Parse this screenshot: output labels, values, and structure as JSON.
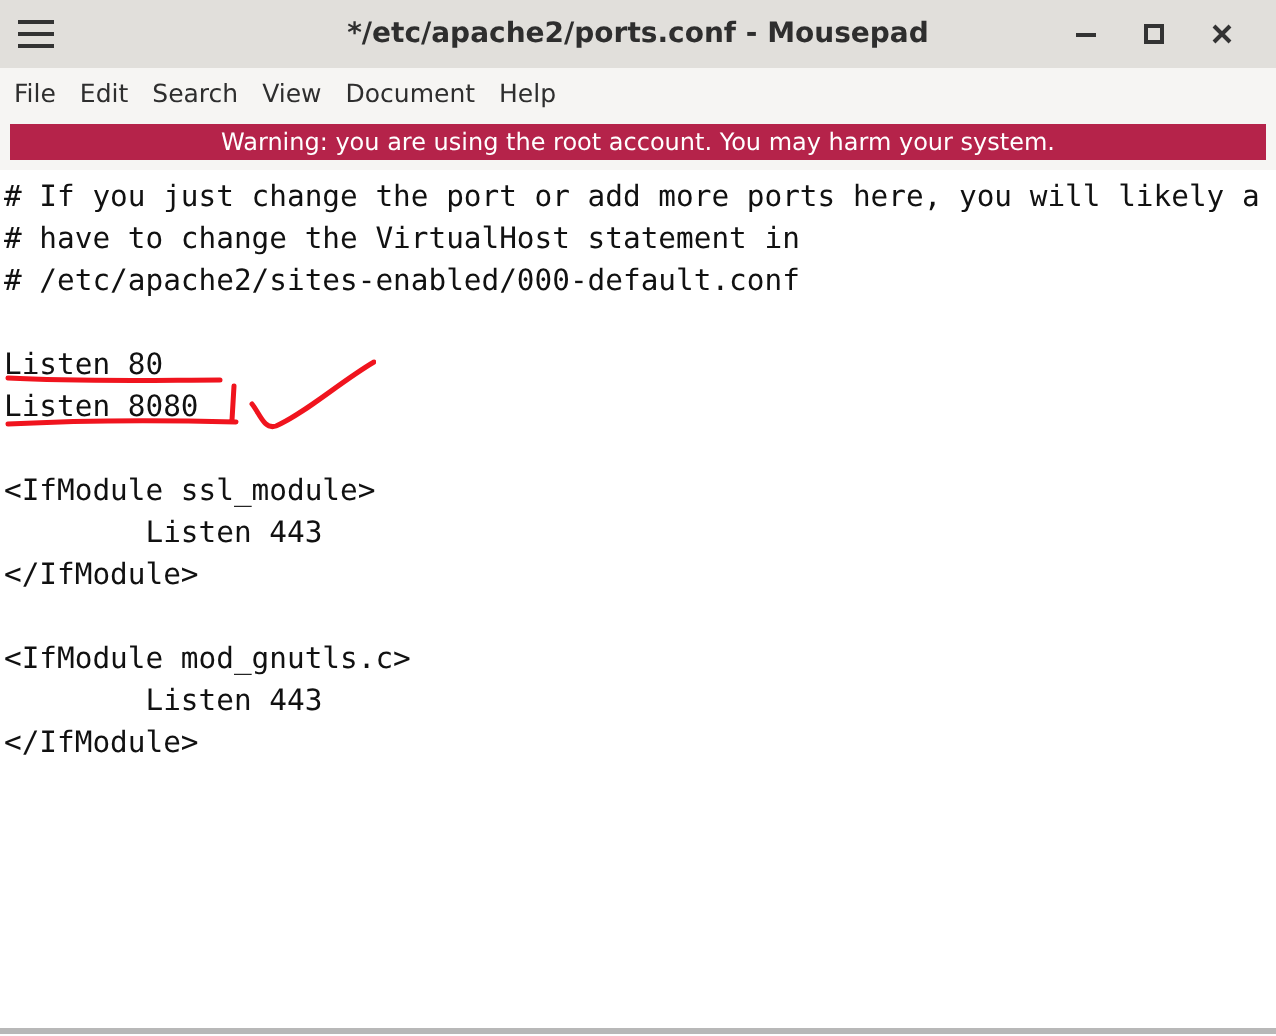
{
  "window": {
    "title": "*/etc/apache2/ports.conf - Mousepad"
  },
  "menu": [
    "File",
    "Edit",
    "Search",
    "View",
    "Document",
    "Help"
  ],
  "warning": "Warning: you are using the root account. You may harm your system.",
  "lines": [
    {
      "kind": "code",
      "text": "# If you just change the port or add more ports here, you will likely a"
    },
    {
      "kind": "code",
      "text": "# have to change the VirtualHost statement in"
    },
    {
      "kind": "code",
      "text": "# /etc/apache2/sites-enabled/000-default.conf"
    },
    {
      "kind": "blank"
    },
    {
      "kind": "code",
      "text": "Listen 80"
    },
    {
      "kind": "code",
      "text": "Listen 8080"
    },
    {
      "kind": "blank"
    },
    {
      "kind": "code",
      "text": "<IfModule ssl_module>"
    },
    {
      "kind": "code",
      "text": "        Listen 443"
    },
    {
      "kind": "code",
      "text": "</IfModule>"
    },
    {
      "kind": "blank"
    },
    {
      "kind": "code",
      "text": "<IfModule mod_gnutls.c>"
    },
    {
      "kind": "code",
      "text": "        Listen 443"
    },
    {
      "kind": "code",
      "text": "</IfModule>"
    }
  ]
}
